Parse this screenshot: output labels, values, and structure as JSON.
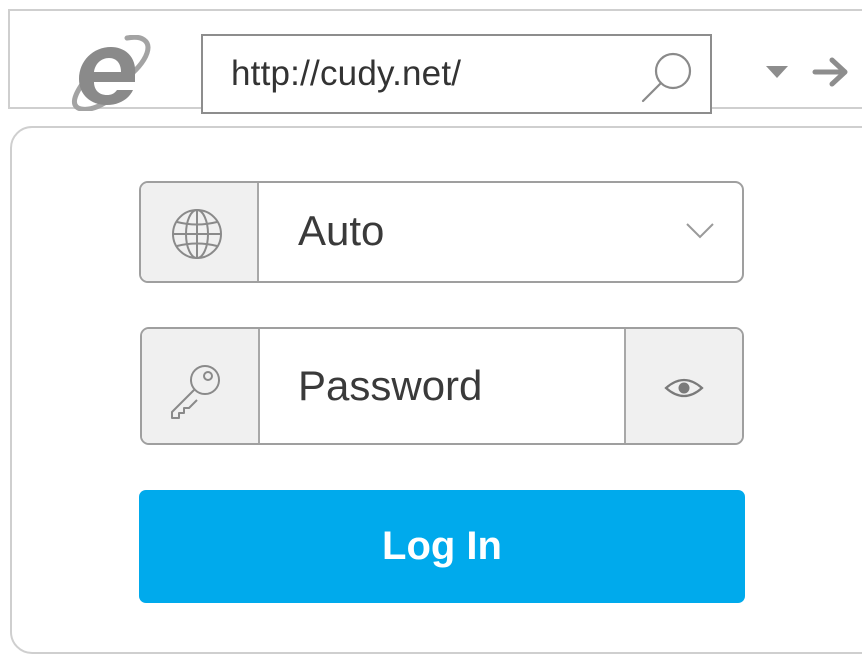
{
  "browser": {
    "address": "http://cudy.net/",
    "icons": {
      "logo": "internet-explorer-logo",
      "search": "search-icon",
      "dropdown": "dropdown-arrow-icon",
      "go": "go-arrow-icon"
    }
  },
  "login": {
    "language": {
      "icon": "globe-icon",
      "selected": "Auto",
      "chevron": "chevron-down-icon"
    },
    "password": {
      "icon": "key-icon",
      "placeholder": "Password",
      "value": "",
      "toggle_icon": "eye-icon"
    },
    "submit_label": "Log In"
  },
  "colors": {
    "primary_button": "#00aaec",
    "border": "#9f9f9f",
    "icon_cell_bg": "#f0f0f0",
    "text": "#3a3a3a"
  }
}
